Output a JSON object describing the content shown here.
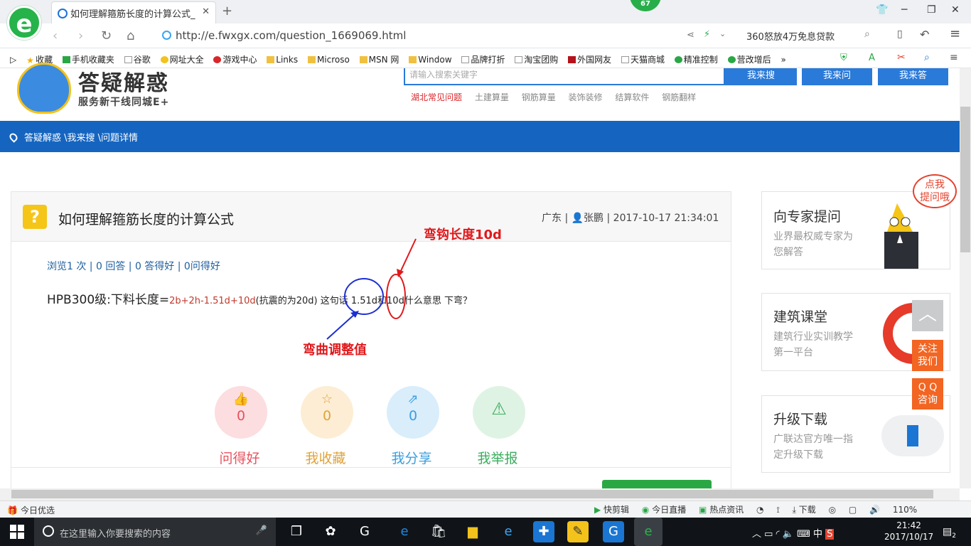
{
  "browser": {
    "logo_glyph": "e",
    "tab_title": "如何理解箍筋长度的计算公式_广",
    "tab_close": "✕",
    "new_tab": "+",
    "badge_count": "67",
    "url": "http://e.fwxgx.com/question_1669069.html",
    "right_search": "360怒放4万免息贷款",
    "bookmarks": [
      "收藏",
      "手机收藏夹",
      "谷歌",
      "网址大全",
      "游戏中心",
      "Links",
      "Microso",
      "MSN 网",
      "Window",
      "品牌打折",
      "淘宝团购",
      "外国网友",
      "天猫商城",
      "精准控制",
      "营改增后"
    ],
    "bookmark_more": "»"
  },
  "site": {
    "brand": "答疑解惑",
    "slogan": "服务新干线同城E+",
    "search_placeholder": "请输入搜索关键字",
    "search_buttons": [
      "我来搜",
      "我来问",
      "我来答"
    ],
    "hot_links": [
      "湖北常见问题",
      "土建算量",
      "钢筋算量",
      "装饰装修",
      "结算软件",
      "钢筋翻样"
    ],
    "breadcrumb": "答疑解惑 \\我来搜 \\问题详情"
  },
  "question": {
    "icon": "?",
    "title": "如何理解箍筋长度的计算公式",
    "meta": "广东 | 👤张鹏 | 2017-10-17 21:34:01",
    "stats": "浏览1 次 | 0 回答 | 0 答得好 | 0问得好",
    "body_prefix": "HPB300级:下料长度=",
    "formula": "2b+2h-1.51d+10d",
    "body_suffix": "(抗震的为20d) 这句话 1.51d和10d什么意思 下弯？",
    "annotation_top": "弯钩长度10d",
    "annotation_bottom": "弯曲调整值",
    "actions": [
      {
        "icon": "👍",
        "count": "0",
        "label": "问得好",
        "color": "#e8525f",
        "bg": "#fcdde0"
      },
      {
        "icon": "☆",
        "count": "0",
        "label": "我收藏",
        "color": "#e0a33a",
        "bg": "#fdedd4"
      },
      {
        "icon": "⇗",
        "count": "0",
        "label": "我分享",
        "color": "#3b9ee0",
        "bg": "#d9edfb"
      },
      {
        "icon": "⚠",
        "count": "",
        "label": "我举报",
        "color": "#3aae5e",
        "bg": "#dff3e4"
      }
    ]
  },
  "sidebar": {
    "bubble": "点我\n提问哦",
    "cards": [
      {
        "title": "向专家提问",
        "sub": "业界最权威专家为您解答"
      },
      {
        "title": "建筑课堂",
        "sub": "建筑行业实训教学第一平台"
      },
      {
        "title": "升级下载",
        "sub": "广联达官方唯一指定升级下载"
      }
    ],
    "float_top": "︿",
    "float_follow": "关注\n我们",
    "float_qq": "Q Q\n咨询"
  },
  "statusbar": {
    "left": "今日优选",
    "items": [
      "快剪辑",
      "今日直播",
      "热点资讯",
      "下载"
    ],
    "zoom": "110%"
  },
  "taskbar": {
    "search_placeholder": "在这里输入你要搜索的内容",
    "ime": "中",
    "time": "21:42",
    "date": "2017/10/17",
    "notifications": "2"
  },
  "colors": {
    "accent_blue": "#1565c0",
    "annotation_red": "#e0191c",
    "annotation_blue": "#1a2fd6",
    "brand_green": "#26b34a"
  }
}
